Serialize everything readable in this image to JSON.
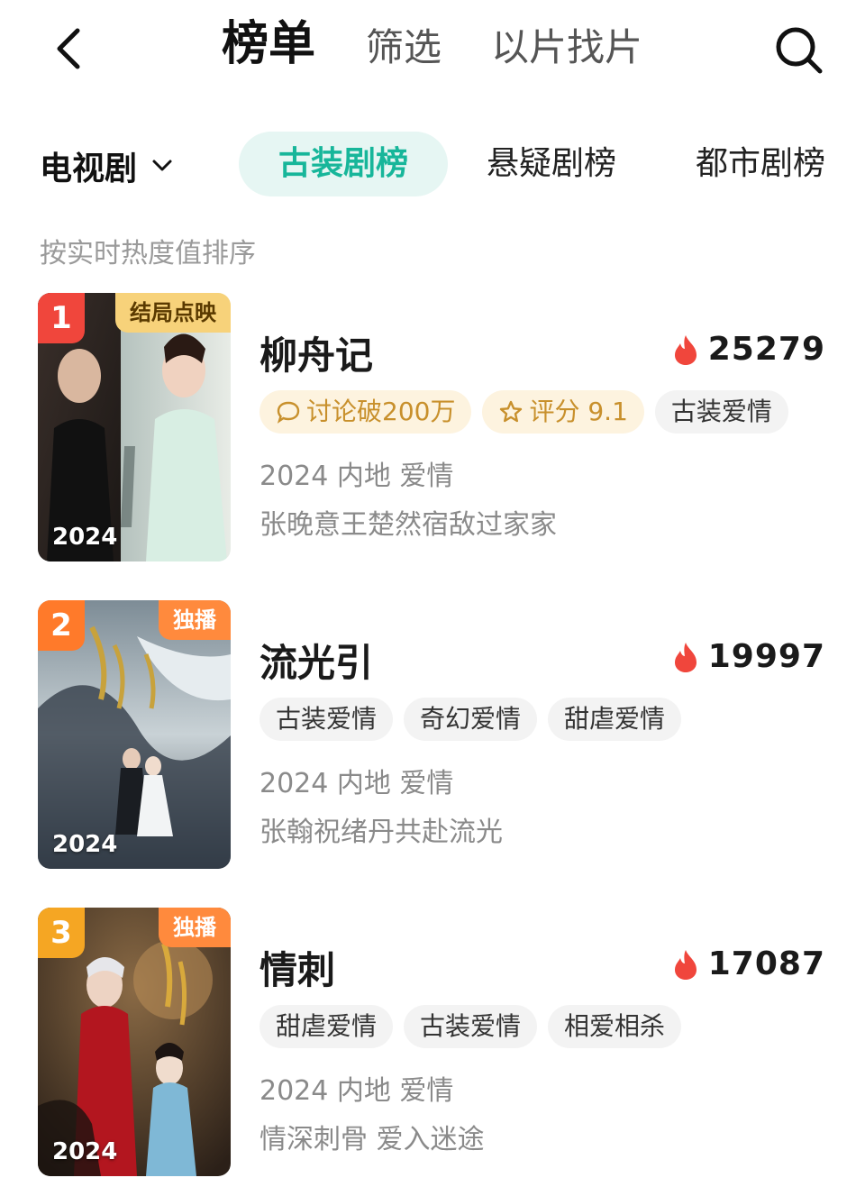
{
  "header": {
    "tabs": [
      {
        "label": "榜单",
        "active": true
      },
      {
        "label": "筛选",
        "active": false
      },
      {
        "label": "以片找片",
        "active": false
      }
    ],
    "back_icon": "chevron-left-icon",
    "search_icon": "search-icon"
  },
  "category": {
    "selected": "电视剧",
    "tabs": [
      {
        "label": "古装剧榜",
        "active": true
      },
      {
        "label": "悬疑剧榜",
        "active": false
      },
      {
        "label": "都市剧榜",
        "active": false
      }
    ],
    "accent_color": "#17b69a"
  },
  "sort_note": "按实时热度值排序",
  "items": [
    {
      "rank": "1",
      "rank_color": "#f0463c",
      "corner_label": "结局点映",
      "corner_color": "#f7d27a",
      "poster_year": "2024",
      "title": "柳舟记",
      "heat": "25279",
      "tags": [
        {
          "label": "讨论破200万",
          "style": "gold",
          "icon": "chat-bubble-icon"
        },
        {
          "label": "评分 9.1",
          "style": "gold",
          "icon": "star-icon"
        },
        {
          "label": "古装爱情",
          "style": "gray"
        }
      ],
      "meta": "2024 内地 爱情",
      "desc": "张晚意王楚然宿敌过家家"
    },
    {
      "rank": "2",
      "rank_color": "#ff7a2a",
      "corner_label": "独播",
      "corner_color": "#ff8a3d",
      "poster_year": "2024",
      "title": "流光引",
      "heat": "19997",
      "tags": [
        {
          "label": "古装爱情",
          "style": "gray"
        },
        {
          "label": "奇幻爱情",
          "style": "gray"
        },
        {
          "label": "甜虐爱情",
          "style": "gray"
        }
      ],
      "meta": "2024 内地 爱情",
      "desc": "张翰祝绪丹共赴流光"
    },
    {
      "rank": "3",
      "rank_color": "#f5a623",
      "corner_label": "独播",
      "corner_color": "#ff8a3d",
      "poster_year": "2024",
      "title": "情刺",
      "heat": "17087",
      "tags": [
        {
          "label": "甜虐爱情",
          "style": "gray"
        },
        {
          "label": "古装爱情",
          "style": "gray"
        },
        {
          "label": "相爱相杀",
          "style": "gray"
        }
      ],
      "meta": "2024 内地 爱情",
      "desc": "情深刺骨 爱入迷途"
    }
  ]
}
